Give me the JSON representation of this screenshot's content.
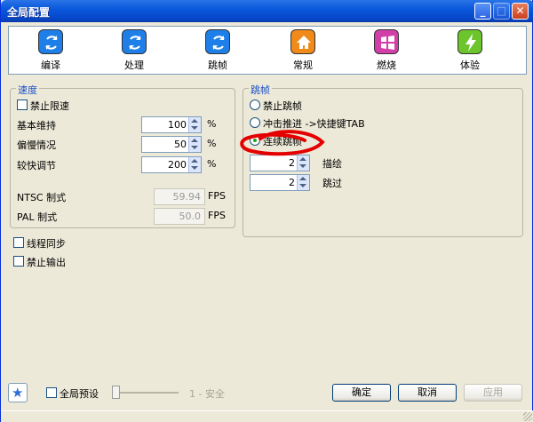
{
  "window": {
    "title": "全局配置",
    "controls": {
      "minimize": "_",
      "maximize": "□",
      "close": "✕"
    }
  },
  "toolbar": {
    "items": [
      {
        "label": "编译",
        "icon": "sync-icon",
        "color": "#1e7fe8"
      },
      {
        "label": "处理",
        "icon": "sync-icon",
        "color": "#1e7fe8"
      },
      {
        "label": "跳帧",
        "icon": "sync-icon",
        "color": "#1e7fe8"
      },
      {
        "label": "常规",
        "icon": "home-icon",
        "color": "#f08a19"
      },
      {
        "label": "燃烧",
        "icon": "windows-icon",
        "color": "#d23fa8"
      },
      {
        "label": "体验",
        "icon": "lightning-icon",
        "color": "#6cc52b"
      }
    ]
  },
  "speed": {
    "legend": "速度",
    "limit_speed_label": "禁止限速",
    "rows": [
      {
        "label": "基本维持",
        "value": "100",
        "unit": "%"
      },
      {
        "label": "偏慢情况",
        "value": "50",
        "unit": "%"
      },
      {
        "label": "较快调节",
        "value": "200",
        "unit": "%"
      }
    ],
    "ntsc": {
      "label": "NTSC 制式",
      "value": "59.94",
      "unit": "FPS"
    },
    "pal": {
      "label": "PAL 制式",
      "value": "50.0",
      "unit": "FPS"
    }
  },
  "frameskip": {
    "legend": "跳帧",
    "options": [
      {
        "label": "禁止跳帧",
        "selected": false
      },
      {
        "label": "冲击推进 ->快捷键TAB",
        "selected": false
      },
      {
        "label": "连续跳帧",
        "selected": true
      }
    ],
    "draw": {
      "value": "2",
      "label": "描绘"
    },
    "skip": {
      "value": "2",
      "label": "跳过"
    }
  },
  "threads": {
    "sync_label": "线程同步",
    "disable_output_label": "禁止输出"
  },
  "footer": {
    "global_preset_label": "全局预设",
    "slider_value": "1 - 安全",
    "ok": "确定",
    "cancel": "取消",
    "apply": "应用"
  }
}
